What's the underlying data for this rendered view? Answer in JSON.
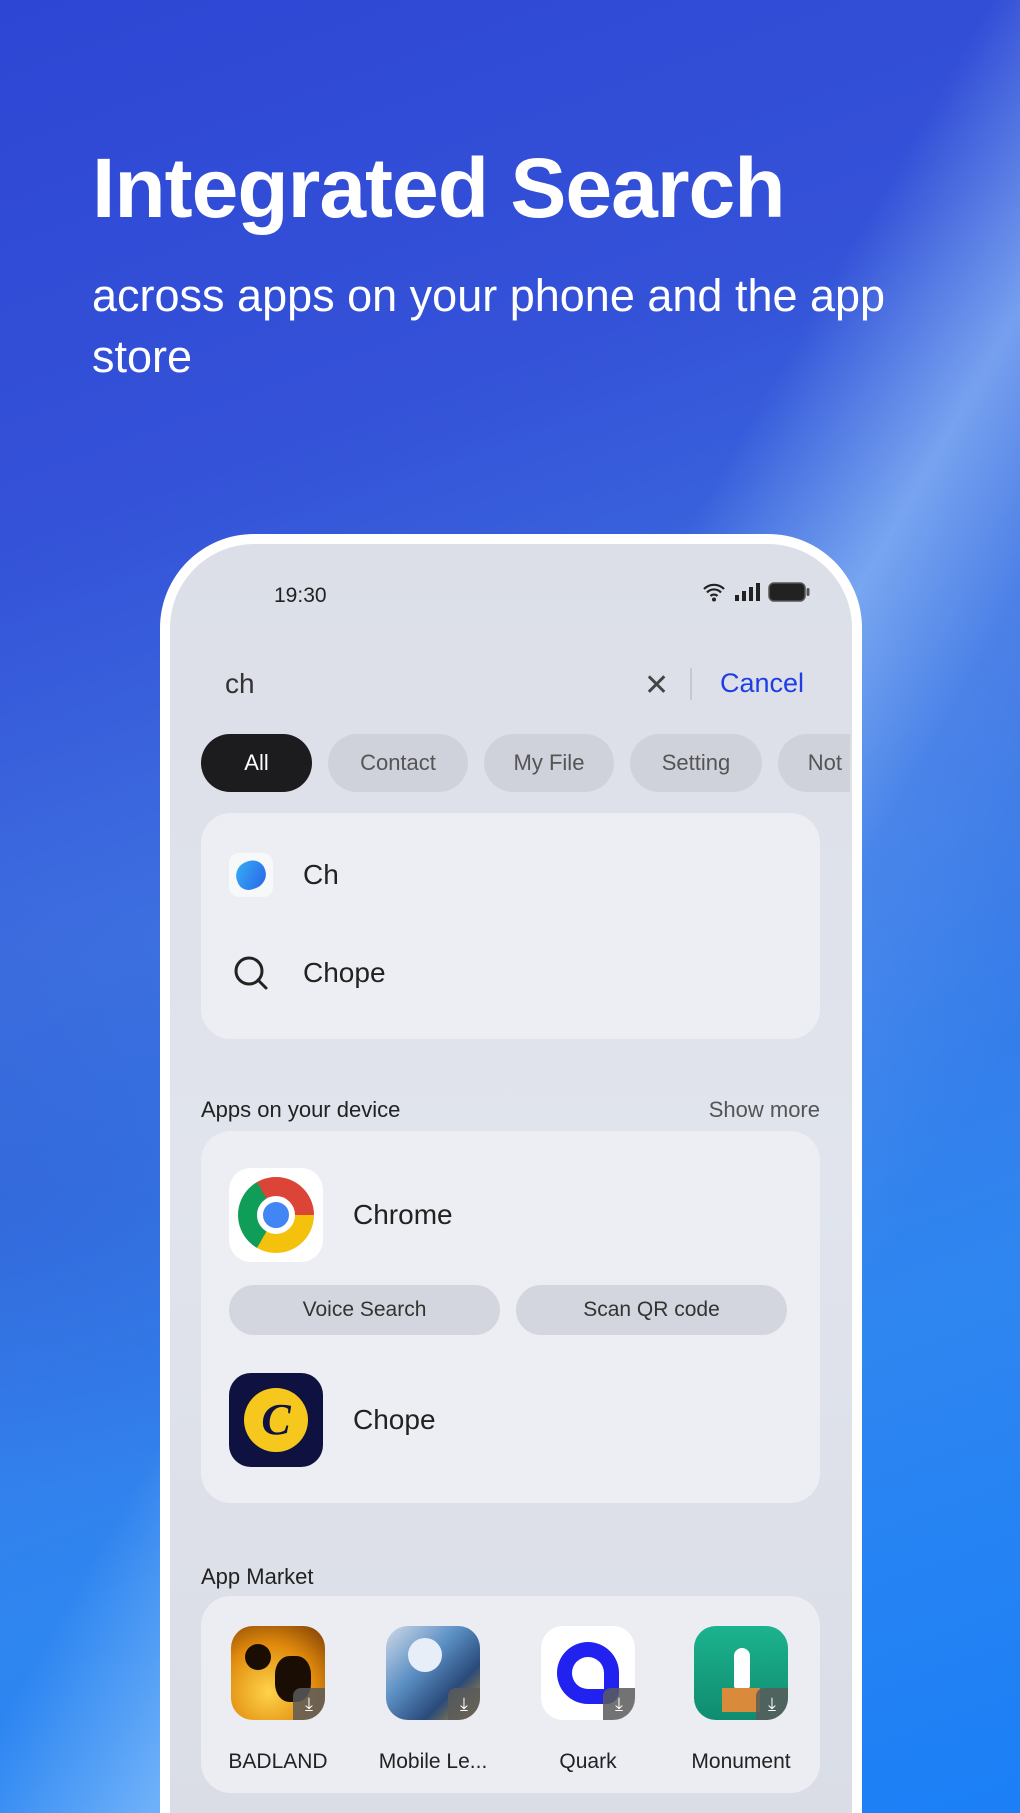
{
  "headline": {
    "title": "Integrated Search",
    "subtitle": "across apps on your phone and the app store"
  },
  "status_bar": {
    "time": "19:30"
  },
  "search": {
    "query": "ch",
    "cancel_label": "Cancel",
    "accent": "#1f3ee6"
  },
  "filters": [
    {
      "label": "All",
      "active": true
    },
    {
      "label": "Contact"
    },
    {
      "label": "My File"
    },
    {
      "label": "Setting"
    },
    {
      "label": "Not"
    }
  ],
  "suggestions": [
    {
      "label": "Ch",
      "icon": "browser-app-icon"
    },
    {
      "label": "Chope",
      "icon": "search-icon"
    }
  ],
  "apps_section": {
    "title": "Apps on your device",
    "show_more": "Show more",
    "apps": [
      {
        "name": "Chrome",
        "actions": [
          "Voice Search",
          "Scan QR code"
        ]
      },
      {
        "name": "Chope"
      }
    ]
  },
  "market": {
    "title": "App Market",
    "apps": [
      {
        "name": "BADLAND"
      },
      {
        "name": "Mobile Le..."
      },
      {
        "name": "Quark"
      },
      {
        "name": "Monument"
      }
    ]
  }
}
